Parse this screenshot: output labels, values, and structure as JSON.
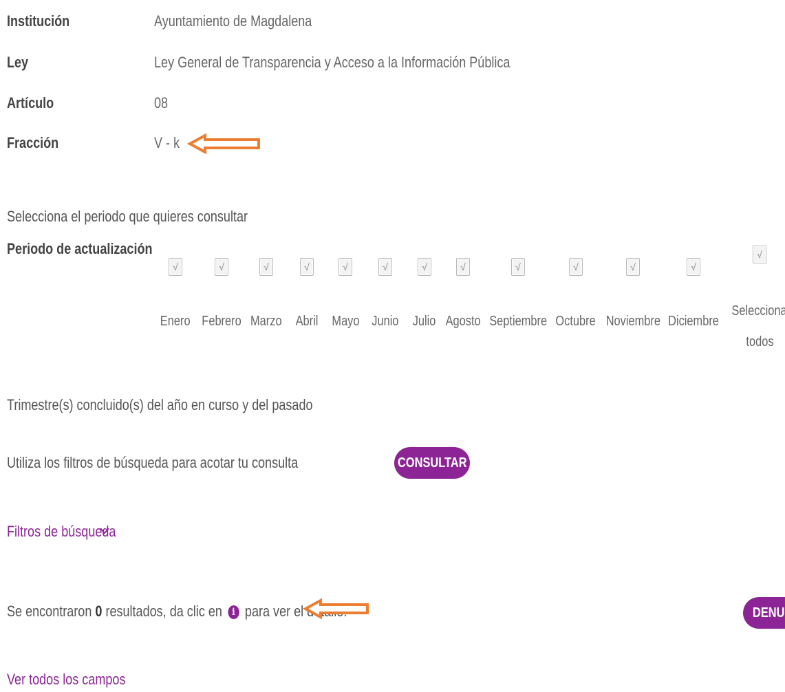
{
  "info": {
    "institucion_label": "Institución",
    "institucion_value": "Ayuntamiento de Magdalena",
    "ley_label": "Ley",
    "ley_value": "Ley General de Transparencia y Acceso a la Información Pública",
    "articulo_label": "Artículo",
    "articulo_value": "08",
    "fraccion_label": "Fracción",
    "fraccion_value": "V - k"
  },
  "periodo": {
    "prompt": "Selecciona el periodo que quieres consultar",
    "label": "Periodo de actualización",
    "months": [
      "Enero",
      "Febrero",
      "Marzo",
      "Abril",
      "Mayo",
      "Junio",
      "Julio",
      "Agosto",
      "Septiembre",
      "Octubre",
      "Noviembre",
      "Diciembre"
    ],
    "select_all_line1": "Seleccionar",
    "select_all_line2": "todos",
    "check_glyph": "√",
    "all_checked": true
  },
  "trimestre_text": "Trimestre(s) concluido(s) del año en curso y del pasado",
  "filters": {
    "hint": "Utiliza los filtros de búsqueda para acotar tu consulta",
    "consultar_label": "CONSULTAR",
    "toggle_label": "Filtros de búsqueda",
    "toggle_icon": "chevron-down-icon"
  },
  "results": {
    "prefix": "Se encontraron",
    "count": "0",
    "middle": "resultados, da clic en",
    "info_glyph": "i",
    "suffix": "para ver el detalle.",
    "denuncia_label": "DENUN"
  },
  "ver_todos_label": "Ver todos los campos",
  "colors": {
    "accent": "#8c2495",
    "annotation_arrow": "#ed7d31"
  }
}
